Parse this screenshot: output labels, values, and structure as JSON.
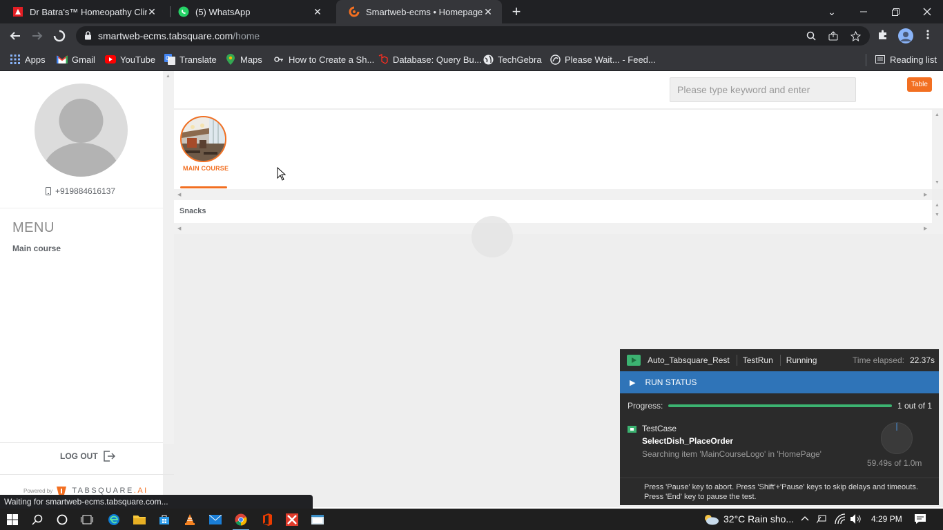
{
  "browser": {
    "tabs": [
      {
        "title": "Dr Batra's™ Homeopathy Clinics |",
        "icon": "batra-icon",
        "active": false
      },
      {
        "title": "(5) WhatsApp",
        "icon": "whatsapp-icon",
        "active": false
      },
      {
        "title": "Smartweb-ecms • Homepage",
        "icon": "tabsquare-icon",
        "active": true
      }
    ],
    "url_host": "smartweb-ecms.tabsquare.com",
    "url_path": "/home",
    "bookmarks": [
      {
        "label": "Apps",
        "icon": "apps-grid-icon"
      },
      {
        "label": "Gmail",
        "icon": "gmail-icon"
      },
      {
        "label": "YouTube",
        "icon": "youtube-icon"
      },
      {
        "label": "Translate",
        "icon": "translate-icon"
      },
      {
        "label": "Maps",
        "icon": "maps-icon"
      },
      {
        "label": "How to Create a Sh...",
        "icon": "key-icon"
      },
      {
        "label": "Database: Query Bu...",
        "icon": "laravel-icon"
      },
      {
        "label": "TechGebra",
        "icon": "globe-icon"
      },
      {
        "label": "Please Wait... - Feed...",
        "icon": "swirl-icon"
      }
    ],
    "reading_list": "Reading list",
    "status_text": "Waiting for smartweb-ecms.tabsquare.com..."
  },
  "sidebar": {
    "phone": "+919884616137",
    "menu_title": "MENU",
    "menu_item": "Main course",
    "logout": "LOG OUT",
    "powered_by": "Powered by",
    "brand": "TABSQUARE",
    "brand_suffix": ".AI"
  },
  "header": {
    "search_placeholder": "Please type keyword and enter",
    "table_badge": "Table"
  },
  "categories": [
    {
      "label": "MAIN COURSE",
      "selected": true
    }
  ],
  "subcategories": [
    {
      "label": "Snacks"
    }
  ],
  "run_status": {
    "project": "Auto_Tabsquare_Rest",
    "run": "TestRun",
    "state": "Running",
    "time_label": "Time elapsed:",
    "time_value": "22.37s",
    "section": "RUN STATUS",
    "progress_label": "Progress:",
    "progress_fraction": 1.0,
    "progress_count": "1 out of 1",
    "case_type": "TestCase",
    "case_name": "SelectDish_PlaceOrder",
    "case_message": "Searching item 'MainCourseLogo' in 'HomePage'",
    "timer": "59.49s of 1.0m",
    "footer_line1": "Press 'Pause' key to abort. Press 'Shift'+'Pause' keys to skip delays and timeouts.",
    "footer_line2": "Press 'End' key to pause the test."
  },
  "taskbar": {
    "weather": "32°C  Rain sho...",
    "time": "4:29 PM"
  },
  "colors": {
    "accent": "#f26f21",
    "chrome_dark": "#202124",
    "chrome_mid": "#35363a",
    "run_blue": "#2f74b8",
    "progress_green": "#3cb371"
  }
}
